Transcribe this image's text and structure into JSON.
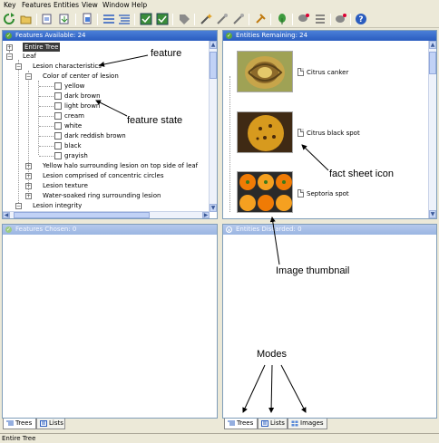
{
  "menu": [
    "Key",
    "Features",
    "Entities",
    "View",
    "Window",
    "Help"
  ],
  "toolbar_icons": [
    "refresh-icon",
    "open-folder-icon",
    "import-icon",
    "export-icon",
    "document-icon",
    "list-view-icon",
    "list-detail-icon",
    "check-image-icon",
    "check-image-2-icon",
    "tag-icon",
    "wand-icon",
    "wand-2-icon",
    "wand-3-icon",
    "pin-icon",
    "leaf-icon",
    "chat-icon",
    "list-2-icon",
    "chat-2-icon",
    "help-icon"
  ],
  "panels": {
    "features_available": {
      "title": "Features Available: 24"
    },
    "entities_remaining": {
      "title": "Entities Remaining: 24"
    },
    "features_chosen": {
      "title": "Features Chosen: 0"
    },
    "entities_discarded": {
      "title": "Entities Discarded: 0"
    }
  },
  "tree": {
    "entire_tree": "Entire Tree",
    "leaf": "Leaf",
    "lesion_characteristics": "Lesion characteristics",
    "color_center": "Color of center of lesion",
    "states": [
      "yellow",
      "dark brown",
      "light brown",
      "cream",
      "white",
      "dark reddish brown",
      "black",
      "grayish"
    ],
    "yellow_halo": "Yellow halo surrounding lesion on top side of leaf",
    "concentric": "Lesion comprised of concentric circles",
    "texture": "Lesion texture",
    "water_soaked": "Water-soaked ring surrounding lesion",
    "integrity": "Lesion integrity"
  },
  "entities": [
    {
      "name": "Citrus canker",
      "colors": [
        "#8d7a3a",
        "#c7a54a",
        "#e4c86a"
      ]
    },
    {
      "name": "Citrus black spot",
      "colors": [
        "#3f2a14",
        "#d79a1e",
        "#f2c245"
      ]
    },
    {
      "name": "Septoria spot",
      "colors": [
        "#f07b05",
        "#2a2a2a",
        "#f5a020"
      ]
    }
  ],
  "tabs_left": [
    "Trees",
    "Lists"
  ],
  "tabs_right": [
    "Trees",
    "Lists",
    "Images"
  ],
  "annotations": {
    "feature": "feature",
    "feature_state": "feature state",
    "fact_sheet_icon": "fact sheet icon",
    "image_thumbnail": "Image thumbnail",
    "modes": "Modes"
  },
  "status": "Entire Tree",
  "colors": {
    "header_active": "#2a5cbf",
    "header_inactive": "#9ab5e2",
    "status_green": "#5fa83a"
  }
}
